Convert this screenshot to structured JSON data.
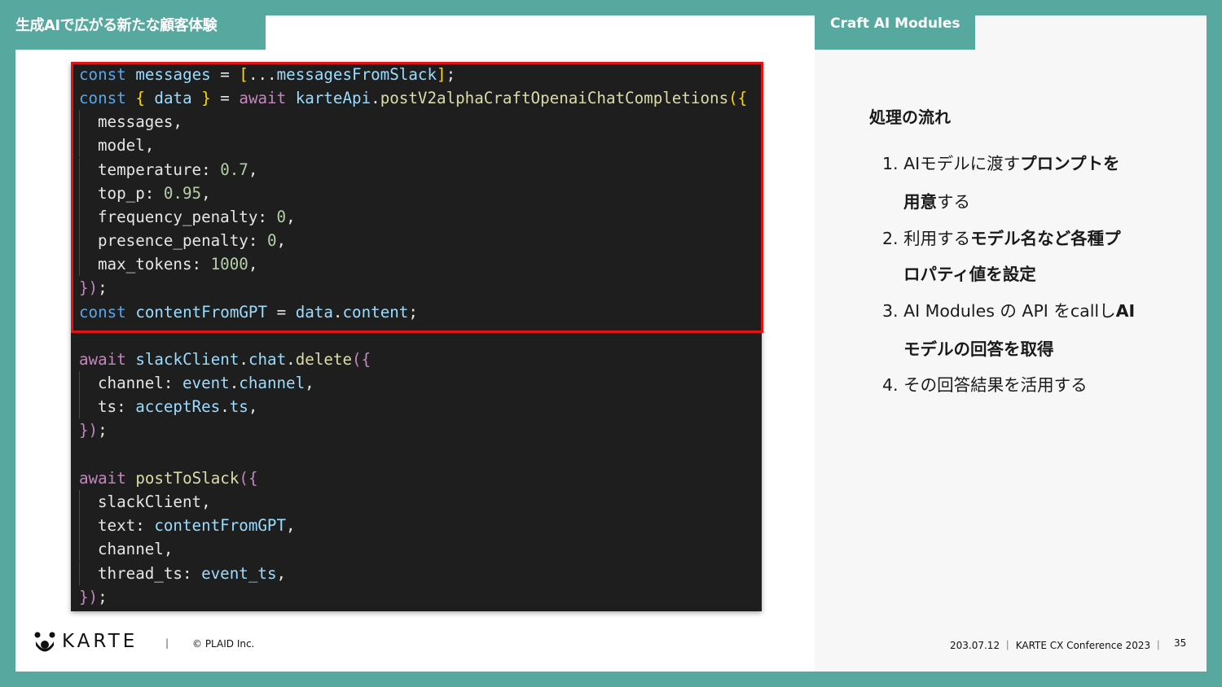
{
  "header": {
    "title": "生成AIで広がる新たな顧客体験",
    "section": "Craft AI Modules"
  },
  "colors": {
    "brand_teal": "#57a9a0",
    "highlight_red": "#e01414",
    "code_bg": "#1e1e1e"
  },
  "code": {
    "l1": {
      "a": "const ",
      "b": "messages",
      "c": " = ",
      "d": "[",
      "e": "...",
      "f": "messagesFromSlack",
      "g": "]",
      "h": ";"
    },
    "l2": {
      "a": "const ",
      "b": "{ ",
      "c": "data",
      "d": " }",
      "e": " = ",
      "f": "await ",
      "g": "karteApi",
      "h": ".",
      "i": "postV2alphaCraftOpenaiChatCompletions",
      "j": "({"
    },
    "l3": {
      "a": "messages,"
    },
    "l4": {
      "a": "model,"
    },
    "l5": {
      "a": "temperature: ",
      "b": "0.7",
      "c": ","
    },
    "l6": {
      "a": "top_p: ",
      "b": "0.95",
      "c": ","
    },
    "l7": {
      "a": "frequency_penalty: ",
      "b": "0",
      "c": ","
    },
    "l8": {
      "a": "presence_penalty: ",
      "b": "0",
      "c": ","
    },
    "l9": {
      "a": "max_tokens: ",
      "b": "1000",
      "c": ","
    },
    "l10": {
      "a": "})",
      "b": ";"
    },
    "l11": {
      "a": "const ",
      "b": "contentFromGPT",
      "c": " = ",
      "d": "data",
      "e": ".",
      "f": "content",
      "g": ";"
    },
    "l12": {
      "a": "await ",
      "b": "slackClient",
      "c": ".",
      "d": "chat",
      "e": ".",
      "f": "delete",
      "g": "({"
    },
    "l13": {
      "a": "channel: ",
      "b": "event",
      "c": ".",
      "d": "channel",
      "e": ","
    },
    "l14": {
      "a": "ts: ",
      "b": "acceptRes",
      "c": ".",
      "d": "ts",
      "e": ","
    },
    "l15": {
      "a": "})",
      "b": ";"
    },
    "l16": {
      "a": "await ",
      "b": "postToSlack",
      "c": "({"
    },
    "l17": {
      "a": "slackClient,"
    },
    "l18": {
      "a": "text: ",
      "b": "contentFromGPT",
      "c": ","
    },
    "l19": {
      "a": "channel,"
    },
    "l20": {
      "a": "thread_ts: ",
      "b": "event_ts",
      "c": ","
    },
    "l21": {
      "a": "})",
      "b": ";"
    }
  },
  "flow": {
    "heading": "処理の流れ",
    "steps": [
      {
        "l1a": "1. AIモデルに渡す",
        "l1b": "プロンプトを",
        "l2a": "用意",
        "l2b": "する"
      },
      {
        "l1a": "2. 利用する",
        "l1b": "モデル名など各種プ",
        "l2a": "ロパティ値を設定"
      },
      {
        "l1a": "3. AI Modules の API をcallし",
        "l1b": "AI",
        "l2a": "モデルの回答を取得"
      },
      {
        "l1a": "4. その回答結果を活用する"
      }
    ]
  },
  "footer": {
    "logo_text": "KARTE",
    "separator": "|",
    "copyright": "© PLAID Inc.",
    "date_event": "203.07.12 ｜ KARTE CX Conference 2023 ｜",
    "page_number": "35"
  }
}
